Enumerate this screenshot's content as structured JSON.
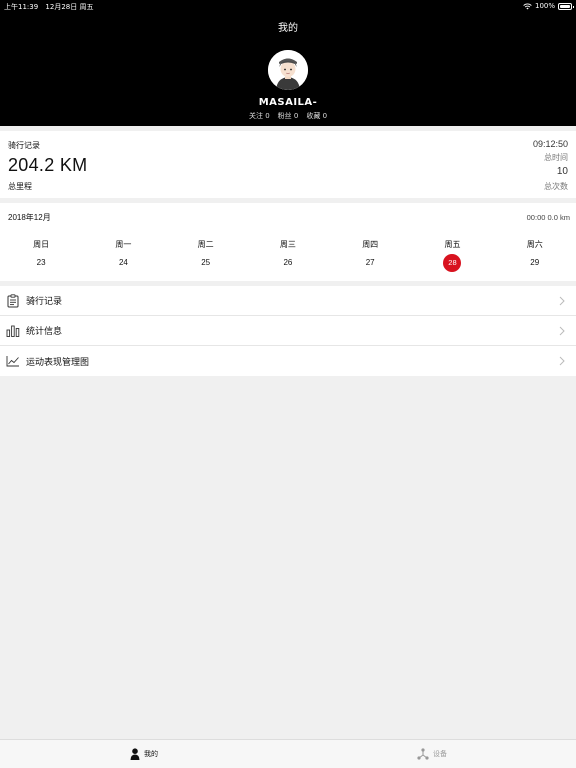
{
  "status_bar": {
    "time": "上午11:39",
    "date": "12月28日 周五",
    "battery": "100%",
    "battery_level": 1.0
  },
  "nav": {
    "title": "我的"
  },
  "profile": {
    "username": "MASAILA-",
    "following": "关注 0",
    "followers": "粉丝 0",
    "favorites": "收藏 0"
  },
  "ride": {
    "label": "骑行记录",
    "distance": "204.2 KM",
    "distance_label": "总里程",
    "time": "09:12:50",
    "time_label": "总时间",
    "count": "10",
    "count_label": "总次数"
  },
  "calendar": {
    "month": "2018年12月",
    "summary": "00:00  0.0 km",
    "weekdays": [
      "周日",
      "周一",
      "周二",
      "周三",
      "周四",
      "周五",
      "周六"
    ],
    "days": [
      "23",
      "24",
      "25",
      "26",
      "27",
      "28",
      "29"
    ],
    "selected_index": 5,
    "accent": "#d8121f"
  },
  "menu": {
    "items": [
      {
        "label": "骑行记录",
        "icon": "clipboard-icon"
      },
      {
        "label": "统计信息",
        "icon": "bar-chart-icon"
      },
      {
        "label": "运动表现管理图",
        "icon": "line-chart-icon"
      }
    ]
  },
  "tabbar": {
    "tabs": [
      {
        "label": "我的",
        "icon": "person-icon",
        "active": true
      },
      {
        "label": "设备",
        "icon": "device-icon",
        "active": false
      }
    ]
  }
}
